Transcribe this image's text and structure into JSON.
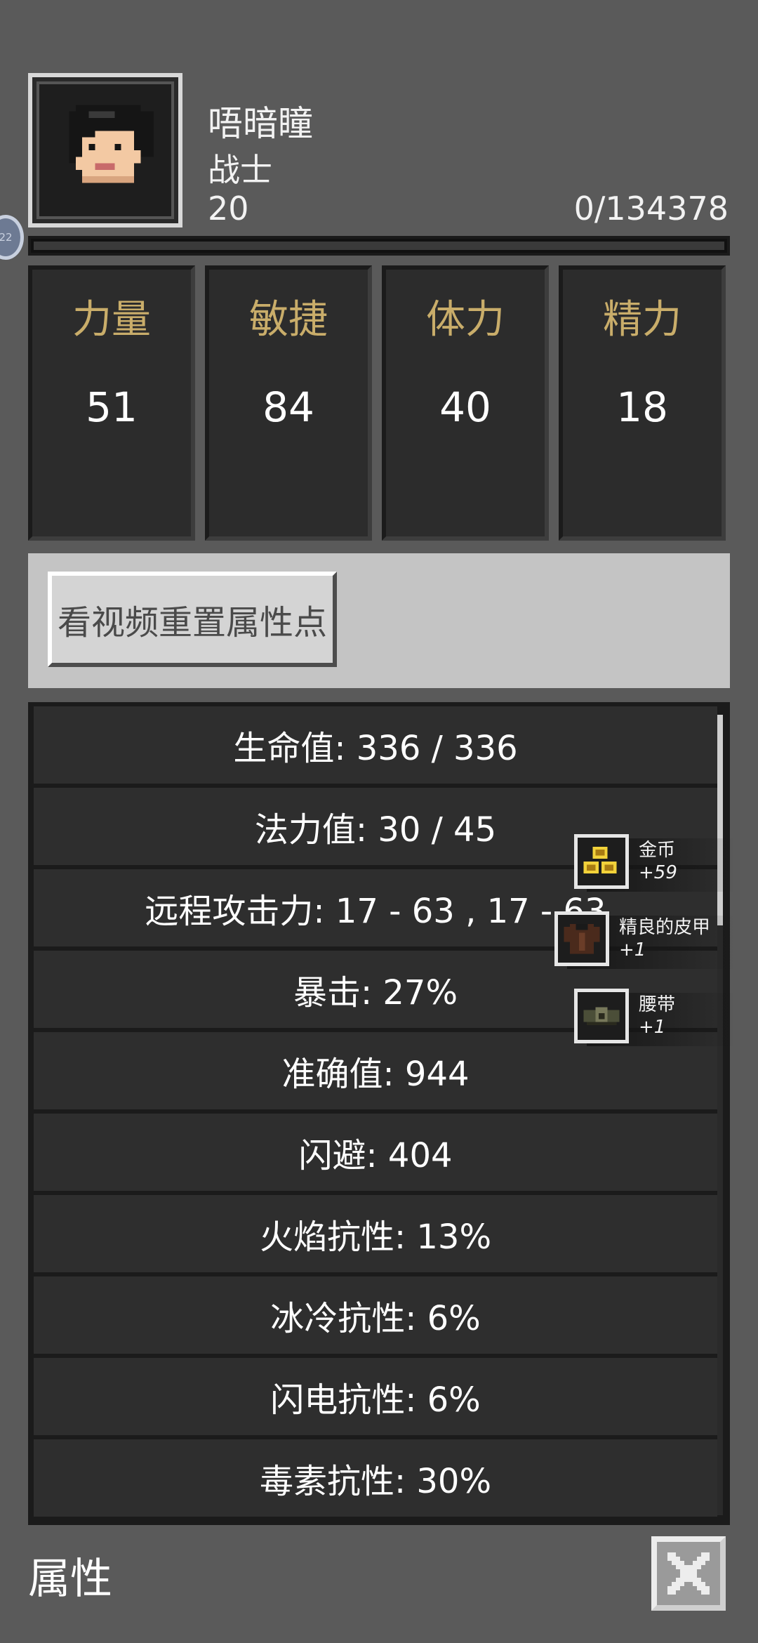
{
  "character": {
    "name": "唔暗瞳",
    "class": "战士",
    "level": "20",
    "xp_text": "0/134378",
    "xp_fraction": 0.0
  },
  "side_badge": "22",
  "attributes": [
    {
      "label": "力量",
      "value": "51"
    },
    {
      "label": "敏捷",
      "value": "84"
    },
    {
      "label": "体力",
      "value": "40"
    },
    {
      "label": "精力",
      "value": "18"
    }
  ],
  "reset_button_label": "看视频重置属性点",
  "stats": [
    "生命值: 336 / 336",
    "法力值: 30 / 45",
    "远程攻击力: 17 - 63 , 17 - 63",
    "暴击: 27%",
    "准确值: 944",
    "闪避: 404",
    "火焰抗性: 13%",
    "冰冷抗性: 6%",
    "闪电抗性: 6%",
    "毒素抗性: 30%"
  ],
  "loot_toasts": [
    {
      "name": "金币",
      "amount": "+59",
      "icon": "gold-coins-icon"
    },
    {
      "name": "精良的皮甲",
      "amount": "+1",
      "icon": "leather-armor-icon"
    },
    {
      "name": "腰带",
      "amount": "+1",
      "icon": "belt-icon"
    }
  ],
  "footer": {
    "title": "属性"
  },
  "colors": {
    "attribute_label": "#c9ad6a",
    "background": "#5a5a5a"
  }
}
